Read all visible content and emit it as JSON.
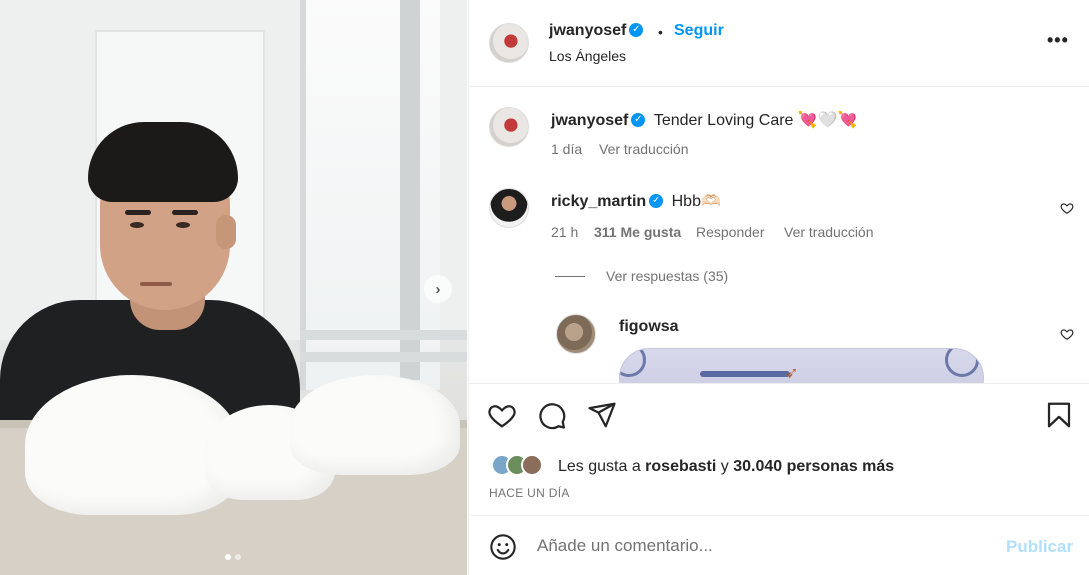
{
  "post": {
    "author": "jwanyosef",
    "follow_label": "Seguir",
    "separator": "•",
    "location": "Los Ángeles",
    "more_label": "•••",
    "carousel": {
      "current": 1,
      "total": 2
    }
  },
  "caption": {
    "author": "jwanyosef",
    "text": "Tender Loving Care 💘🤍💘",
    "time": "1 día",
    "translate_label": "Ver traducción"
  },
  "comments": [
    {
      "author": "ricky_martin",
      "text": "Hbb🫶🏻",
      "time": "21 h",
      "likes": "311 Me gusta",
      "reply_label": "Responder",
      "translate_label": "Ver traducción",
      "view_replies_label": "Ver respuestas (35)"
    },
    {
      "author": "figowsa"
    }
  ],
  "likes": {
    "prefix": "Les gusta a ",
    "user": "rosebasti",
    "middle": " y ",
    "others": "30.040 personas más"
  },
  "time_ago": "HACE UN DÍA",
  "comment_box": {
    "placeholder": "Añade un comentario...",
    "publish_label": "Publicar"
  },
  "colors": {
    "accent": "#0095f6",
    "publish_disabled": "#b2dffc",
    "muted": "#737373"
  }
}
